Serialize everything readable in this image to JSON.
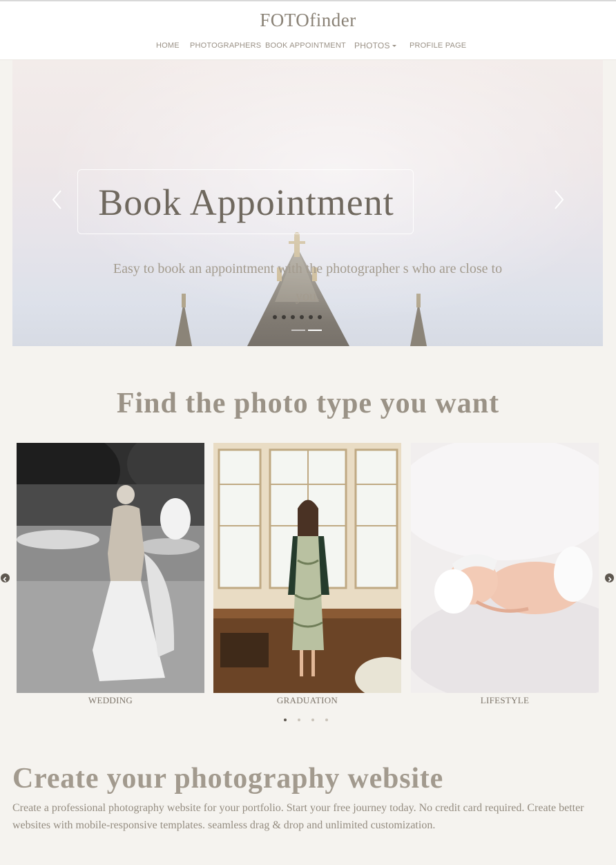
{
  "header": {
    "brand": "FOTOfinder",
    "nav": [
      {
        "label": "HOME"
      },
      {
        "label": "PHOTOGRAPHERS"
      },
      {
        "label": "BOOK APPOINTMENT"
      },
      {
        "label": "PHOTOS"
      },
      {
        "label": "PROFILE PAGE"
      }
    ]
  },
  "hero": {
    "title": "Book Appointment",
    "subtitle": "Easy to book an appointment with the photographer s who are close to you.",
    "indicator_count": 2,
    "active_indicator": 1
  },
  "photo_types": {
    "title": "Find the photo type you want",
    "cards": [
      {
        "label": "WEDDING"
      },
      {
        "label": "GRADUATION"
      },
      {
        "label": "LIFESTYLE"
      }
    ],
    "page_dots": 4,
    "active_dot": 0
  },
  "website": {
    "title": "Create your photography website",
    "text": "Create a professional photography website for your portfolio. Start your free journey today. No credit card required. Create better websites with mobile-responsive templates. seamless drag & drop and unlimited customization."
  },
  "colors": {
    "page_bg": "#f5f3ef",
    "text": "#8a8276",
    "accent_dark": "#5e574f"
  }
}
